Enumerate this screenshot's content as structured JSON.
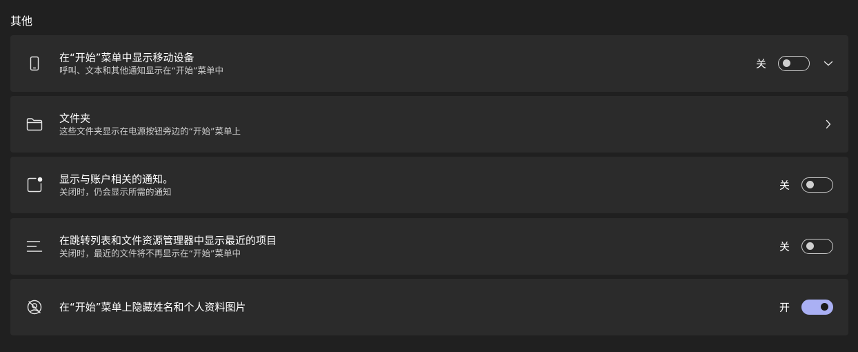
{
  "section": {
    "title": "其他"
  },
  "rows": [
    {
      "title": "在“开始”菜单中显示移动设备",
      "description": "呼叫、文本和其他通知显示在“开始”菜单中",
      "state_label": "关",
      "toggle_on": false,
      "icon": "phone-icon",
      "trailing": "chevron-down-icon"
    },
    {
      "title": "文件夹",
      "description": "这些文件夹显示在电源按钮旁边的“开始”菜单上",
      "icon": "folder-icon",
      "trailing": "chevron-right-icon"
    },
    {
      "title": "显示与账户相关的通知。",
      "description": "关闭时，仍会显示所需的通知",
      "state_label": "关",
      "toggle_on": false,
      "icon": "account-notification-icon"
    },
    {
      "title": "在跳转列表和文件资源管理器中显示最近的项目",
      "description": "关闭时，最近的文件将不再显示在“开始”菜单中",
      "state_label": "关",
      "toggle_on": false,
      "icon": "list-icon"
    },
    {
      "title": "在“开始”菜单上隐藏姓名和个人资料图片",
      "state_label": "开",
      "toggle_on": true,
      "icon": "hidden-profile-icon"
    }
  ],
  "colors": {
    "background": "#202020",
    "card": "#2b2b2b",
    "accent": "#aab0f4"
  }
}
